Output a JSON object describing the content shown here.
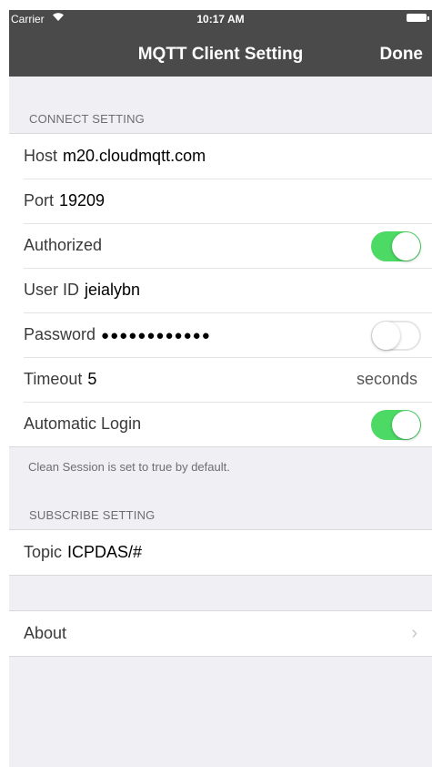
{
  "status_bar": {
    "carrier": "Carrier",
    "time": "10:17 AM"
  },
  "nav": {
    "title": "MQTT Client Setting",
    "done_label": "Done"
  },
  "connect": {
    "header": "CONNECT SETTING",
    "host": {
      "label": "Host",
      "value": "m20.cloudmqtt.com"
    },
    "port": {
      "label": "Port",
      "value": "19209"
    },
    "authorized": {
      "label": "Authorized",
      "on": true
    },
    "user_id": {
      "label": "User ID",
      "value": "jeialybn"
    },
    "password": {
      "label": "Password",
      "value": "●●●●●●●●●●●●",
      "show": false
    },
    "timeout": {
      "label": "Timeout",
      "value": "5",
      "unit": "seconds"
    },
    "auto_login": {
      "label": "Automatic Login",
      "on": true
    },
    "footer": "Clean Session is set to true by default."
  },
  "subscribe": {
    "header": "SUBSCRIBE SETTING",
    "topic": {
      "label": "Topic",
      "value": "ICPDAS/#"
    }
  },
  "about": {
    "label": "About"
  },
  "colors": {
    "toggle_on": "#4cd964",
    "nav_bg": "#4a4a4a",
    "background": "#efeff4"
  }
}
